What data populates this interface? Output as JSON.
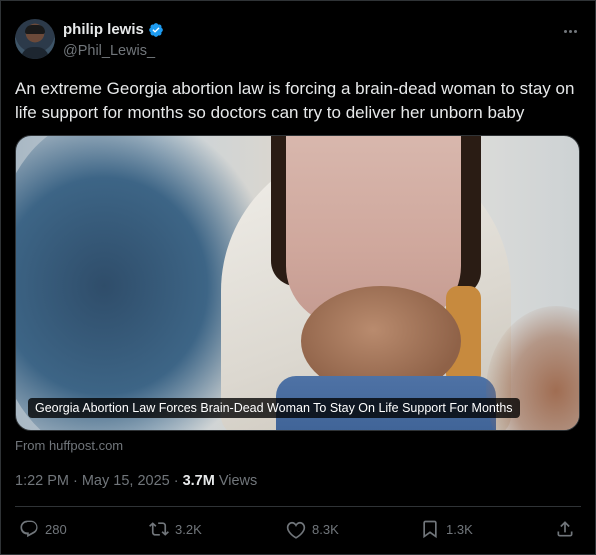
{
  "author": {
    "display_name": "philip lewis",
    "handle": "@Phil_Lewis_",
    "verified": true
  },
  "tweet": {
    "text": "An extreme Georgia abortion law is forcing a brain-dead woman to stay on life support for months so doctors can try to deliver her unborn baby"
  },
  "card": {
    "caption": "Georgia Abortion Law Forces Brain-Dead Woman To Stay On Life Support For Months",
    "source": "From huffpost.com"
  },
  "meta": {
    "time": "1:22 PM",
    "separator1": "·",
    "date": "May 15, 2025",
    "separator2": "·",
    "views_count": "3.7M",
    "views_label": "Views"
  },
  "actions": {
    "replies": "280",
    "reposts": "3.2K",
    "likes": "8.3K",
    "bookmarks": "1.3K"
  },
  "colors": {
    "background": "#000000",
    "text": "#e7e9ea",
    "muted": "#71767b",
    "verified": "#1d9bf0",
    "border": "#2f3336"
  },
  "icons": [
    "verified-icon",
    "more-icon",
    "reply-icon",
    "repost-icon",
    "like-icon",
    "bookmark-icon",
    "share-icon"
  ]
}
